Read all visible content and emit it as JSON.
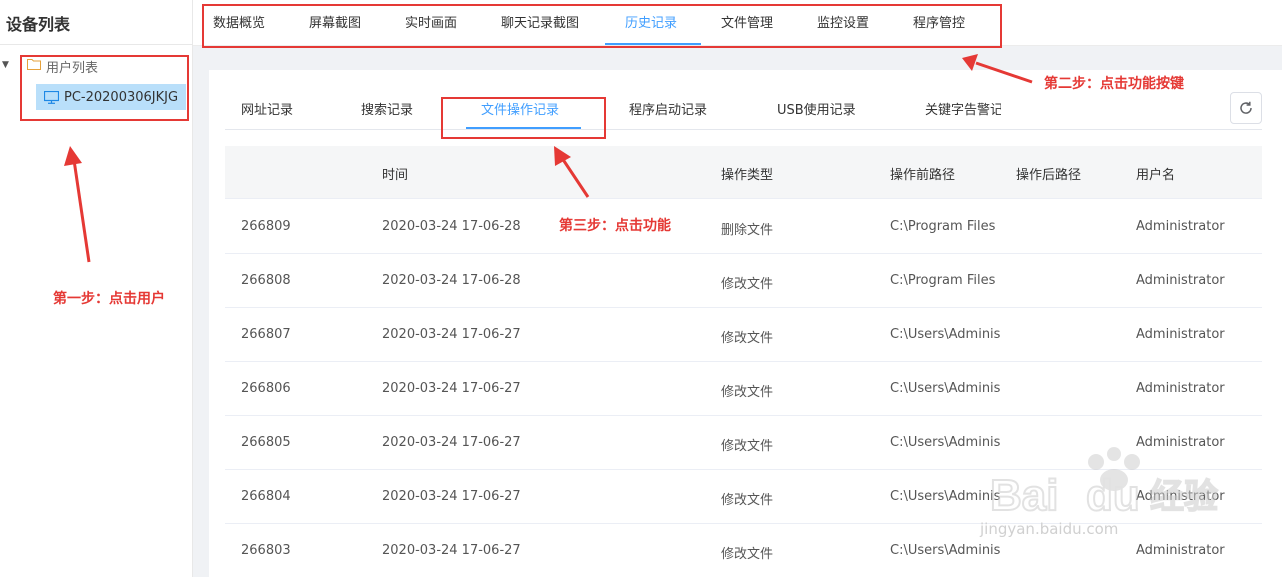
{
  "sidebar": {
    "title": "设备列表",
    "tree_root": "用户列表",
    "device": "PC-20200306JKJG"
  },
  "top_nav": {
    "tabs": [
      {
        "label": "数据概览"
      },
      {
        "label": "屏幕截图"
      },
      {
        "label": "实时画面"
      },
      {
        "label": "聊天记录截图"
      },
      {
        "label": "历史记录",
        "active": true
      },
      {
        "label": "文件管理"
      },
      {
        "label": "监控设置"
      },
      {
        "label": "程序管控"
      }
    ]
  },
  "sub_tabs": [
    {
      "label": "网址记录"
    },
    {
      "label": "搜索记录"
    },
    {
      "label": "文件操作记录",
      "active": true
    },
    {
      "label": "程序启动记录"
    },
    {
      "label": "USB使用记录"
    },
    {
      "label": "关键字告警记录"
    }
  ],
  "table": {
    "headers": [
      "",
      "时间",
      "操作类型",
      "操作前路径",
      "操作后路径",
      "用户名"
    ],
    "rows": [
      [
        "266809",
        "2020-03-24 17-06-28",
        "删除文件",
        "C:\\Program Files",
        "",
        "Administrator"
      ],
      [
        "266808",
        "2020-03-24 17-06-28",
        "修改文件",
        "C:\\Program Files",
        "",
        "Administrator"
      ],
      [
        "266807",
        "2020-03-24 17-06-27",
        "修改文件",
        "C:\\Users\\Adminis",
        "",
        "Administrator"
      ],
      [
        "266806",
        "2020-03-24 17-06-27",
        "修改文件",
        "C:\\Users\\Adminis",
        "",
        "Administrator"
      ],
      [
        "266805",
        "2020-03-24 17-06-27",
        "修改文件",
        "C:\\Users\\Adminis",
        "",
        "Administrator"
      ],
      [
        "266804",
        "2020-03-24 17-06-27",
        "修改文件",
        "C:\\Users\\Adminis",
        "",
        "Administrator"
      ],
      [
        "266803",
        "2020-03-24 17-06-27",
        "修改文件",
        "C:\\Users\\Adminis",
        "",
        "Administrator"
      ]
    ]
  },
  "annotations": {
    "step1": "第一步：点击用户",
    "step2": "第二步：点击功能按键",
    "step3": "第三步：点击功能"
  },
  "icons": {
    "folder": "folder-icon",
    "monitor": "monitor-icon",
    "refresh": "refresh-icon",
    "caret": "caret-down-icon"
  },
  "colors": {
    "accent": "#409eff",
    "annotation": "#e53935",
    "selected_bg": "#b9dffa"
  },
  "watermark": {
    "brand": "Bai du 经验",
    "url": "jingyan.baidu.com"
  }
}
